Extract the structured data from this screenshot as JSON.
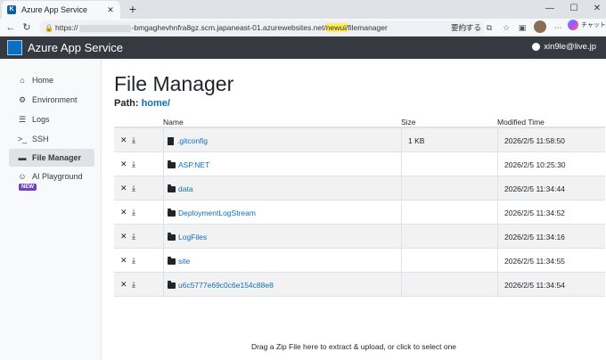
{
  "browser": {
    "tab_title": "Azure App Service",
    "tab_close": "✕",
    "new_tab": "+",
    "url_prefix": "https://",
    "url_host": "-bmgaghevhnfra8gz.scm.japaneast-01.azurewebsites.net/",
    "url_highlight": "newui/",
    "url_path": "filemanager",
    "translate_label": "要約する",
    "copilot_label": "チャット",
    "window_controls": [
      "—",
      "☐",
      "✕"
    ]
  },
  "navbar": {
    "brand": "Azure App Service",
    "user": "xin9le@live.jp"
  },
  "sidebar": {
    "items": [
      {
        "label": "Home",
        "icon": "home-icon",
        "glyph": "⌂"
      },
      {
        "label": "Environment",
        "icon": "gears-icon",
        "glyph": "⚙"
      },
      {
        "label": "Logs",
        "icon": "list-icon",
        "glyph": "☰"
      },
      {
        "label": "SSH",
        "icon": "terminal-icon",
        "glyph": ">_"
      },
      {
        "label": "File Manager",
        "icon": "folder-icon",
        "glyph": "▬"
      },
      {
        "label": "AI Playground",
        "icon": "robot-icon",
        "glyph": "☺"
      }
    ],
    "new_badge": "NEW"
  },
  "main": {
    "title": "File Manager",
    "path_label": "Path:",
    "path_link": "home/",
    "columns": {
      "name": "Name",
      "size": "Size",
      "modified": "Modified Time"
    },
    "files": [
      {
        "name": ".gitconfig",
        "type": "file",
        "size": "1 KB",
        "modified": "2026/2/5 11:58:50"
      },
      {
        "name": "ASP.NET",
        "type": "folder",
        "size": "",
        "modified": "2026/2/5 10:25:30"
      },
      {
        "name": "data",
        "type": "folder",
        "size": "",
        "modified": "2026/2/5 11:34:44"
      },
      {
        "name": "DeploymentLogStream",
        "type": "folder",
        "size": "",
        "modified": "2026/2/5 11:34:52"
      },
      {
        "name": "LogFiles",
        "type": "folder",
        "size": "",
        "modified": "2026/2/5 11:34:16"
      },
      {
        "name": "site",
        "type": "folder",
        "size": "",
        "modified": "2026/2/5 11:34:55"
      },
      {
        "name": "u6c5777e69c0c6e154c88e8",
        "type": "folder",
        "size": "",
        "modified": "2026/2/5 11:34:54"
      }
    ],
    "dropzone": "Drag a Zip File here to extract & upload, or click to select one"
  }
}
